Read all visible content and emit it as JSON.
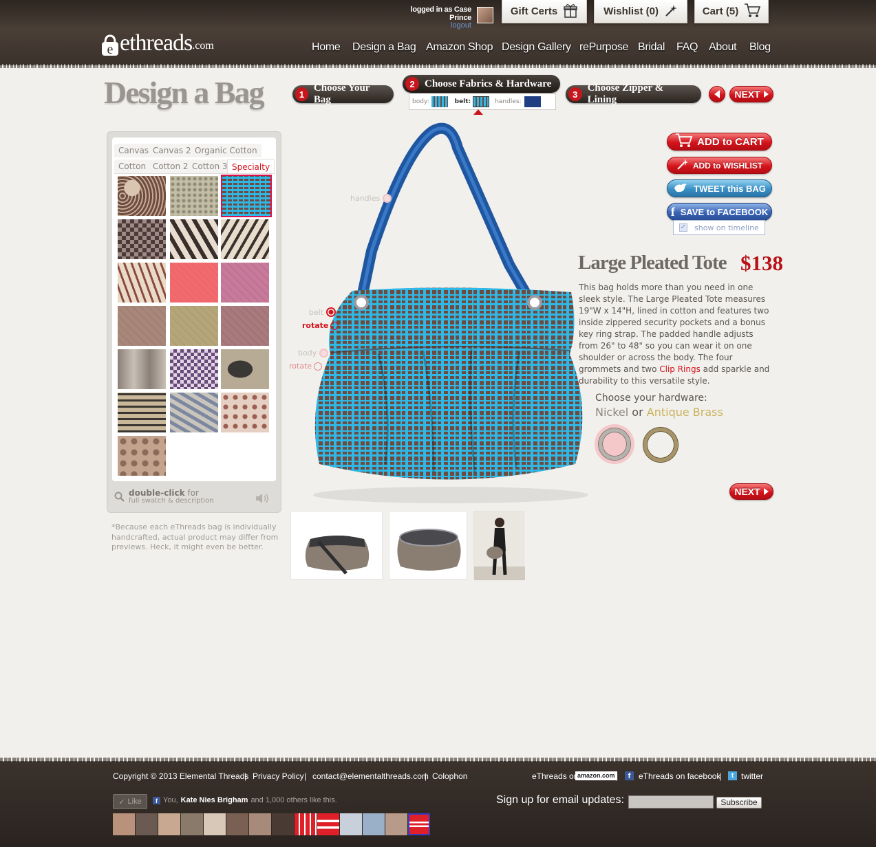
{
  "header": {
    "logo": "ethreads",
    "logo_suffix": ".com",
    "logged_in_text": "logged in as Case Prince",
    "logout": "logout",
    "gift_certs": "Gift Certs",
    "wishlist": "Wishlist (0)",
    "cart": "Cart (5)",
    "nav": [
      "Home",
      "Design a Bag",
      "Amazon Shop",
      "Design Gallery",
      "rePurpose",
      "Bridal",
      "FAQ",
      "About",
      "Blog"
    ]
  },
  "page_title": "Design a Bag",
  "steps": [
    {
      "num": "1",
      "label": "Choose Your Bag"
    },
    {
      "num": "2",
      "label": "Choose Fabrics & Hardware"
    },
    {
      "num": "3",
      "label": "Choose Zipper & Lining"
    }
  ],
  "step2_parts": {
    "body": "body:",
    "belt": "belt:",
    "handles": "handles:"
  },
  "next_label": "NEXT",
  "fabric_tabs_row1": [
    "Canvas",
    "Canvas 2",
    "Organic Cotton"
  ],
  "fabric_tabs_row2": [
    "Cotton",
    "Cotton 2",
    "Cotton 3",
    "Specialty"
  ],
  "panel_footer": {
    "bold": "double-click",
    "rest": "for",
    "line2": "full swatch & description"
  },
  "disclaimer": "*Because each eThreads bag is individually handcrafted, actual product may differ from previews.  Heck, it might even be better.",
  "bag_labels": {
    "handles": "handles",
    "belt": "belt",
    "rotate1": "rotate",
    "body": "body",
    "rotate2": "rotate"
  },
  "actions": {
    "add_to_cart": "ADD to CART",
    "add_to_wishlist": "ADD to WISHLIST",
    "tweet": "TWEET this BAG",
    "facebook": "SAVE to FACEBOOK",
    "timeline": "show on timeline"
  },
  "product": {
    "name": "Large Pleated Tote",
    "price": "$138",
    "desc_before": "This bag holds more than you need in one sleek style. The Large Pleated Tote measures 19\"W x 14\"H, lined in cotton and features two inside zippered security pockets and a bonus key ring strap. The padded handle adjusts from 26\" to 48\" so you can wear it on one shoulder or across the body. The four grommets and two ",
    "desc_link": "Clip Rings",
    "desc_after": " add sparkle and durability to this versatile style."
  },
  "hardware": {
    "label": "Choose your hardware:",
    "nickel": "Nickel",
    "or": "or",
    "brass": "Antique Brass"
  },
  "footer": {
    "copyright": "Copyright © 2013 Elemental Threads",
    "privacy": "Privacy Policy",
    "contact": "contact@elementalthreads.com",
    "colophon": "Colophon",
    "amazon_pre": "eThreads on",
    "amazon": "amazon.com",
    "facebook": "eThreads on facebook",
    "twitter": "twitter",
    "like": "Like",
    "like_text_pre": "You,",
    "like_name": "Kate Nies Brigham",
    "like_text_post": "and 1,000 others like this.",
    "signup": "Sign up for email updates:",
    "subscribe": "Subscribe"
  },
  "colors": {
    "accent_red": "#d3141c",
    "brass": "#c9b25a",
    "bag_blue": "#2fb8e6",
    "bag_brown": "#6e4a3f",
    "handle_blue": "#1f56a0"
  }
}
